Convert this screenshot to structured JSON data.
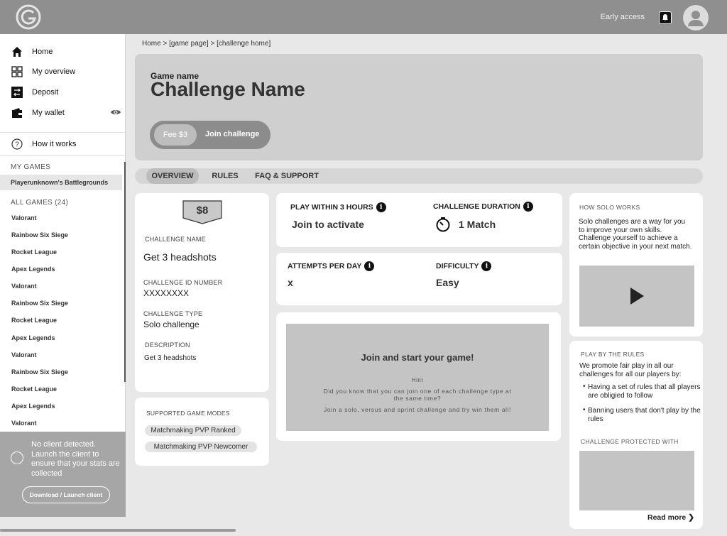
{
  "topbar": {
    "early_access": "Early access"
  },
  "sidebar": {
    "nav": [
      {
        "label": "Home",
        "icon": "home-icon"
      },
      {
        "label": "My overview",
        "icon": "grid-icon"
      },
      {
        "label": "Deposit",
        "icon": "swap-icon"
      },
      {
        "label": "My wallet",
        "icon": "wallet-icon"
      }
    ],
    "how_it_works": "How it works",
    "my_games_title": "MY GAMES",
    "my_games": [
      "Playerunknown's Battlegrounds"
    ],
    "all_games_title": "ALL GAMES (24)",
    "all_games": [
      "Valorant",
      "Rainbow Six Siege",
      "Rocket League",
      "Apex Legends",
      "Valorant",
      "Rainbow Six Siege",
      "Rocket League",
      "Apex Legends",
      "Valorant",
      "Rainbow Six Siege",
      "Rocket League",
      "Apex Legends",
      "Valorant"
    ],
    "client_message": "No client detected. Launch the client to ensure that your stats are collected",
    "download_button": "Download / Launch client"
  },
  "breadcrumb": "Home > [game page] > [challenge home]",
  "hero": {
    "game_name": "Game name",
    "challenge_name": "Challenge Name",
    "fee": "Fee $3",
    "join": "Join challenge"
  },
  "tabs": [
    "OVERVIEW",
    "RULES",
    "FAQ & SUPPORT"
  ],
  "details": {
    "price": "$8",
    "name_label": "CHALLENGE NAME",
    "name_value": "Get 3 headshots",
    "id_label": "CHALLENGE ID NUMBER",
    "id_value": "XXXXXXXX",
    "type_label": "CHALLENGE TYPE",
    "type_value": "Solo challenge",
    "desc_label": "DESCRIPTION",
    "desc_value": "Get 3 headshots"
  },
  "modes": {
    "title": "SUPPORTED GAME MODES",
    "items": [
      "Matchmaking PVP Ranked",
      "Matchmaking PVP Newcomer"
    ]
  },
  "stats": {
    "play_within_label": "PLAY WITHIN 3 HOURS",
    "play_within_value": "Join to activate",
    "duration_label": "CHALLENGE DURATION",
    "duration_value": "1 Match",
    "attempts_label": "ATTEMPTS PER DAY",
    "attempts_value": "x",
    "difficulty_label": "DIFFICULTY",
    "difficulty_value": "Easy",
    "info_glyph": "i"
  },
  "hint": {
    "title": "Join and start your game!",
    "label": "Hint",
    "line1": "Did you know that you can join one of each challenge type at the same time?",
    "line2": "Join a solo, versus and sprint challenge and try win them all!"
  },
  "how_solo": {
    "title": "HOW SOLO WORKS",
    "text": "Solo challenges are a way for you to improve your own skills. Challenge yourself to achieve a certain objective in your next match."
  },
  "rules": {
    "title": "PLAY BY THE RULES",
    "intro": "We promote fair play in all our challenges for all our players by:",
    "bullets": [
      "Having a set of rules that all players are obligied to follow",
      "Banning users that don't play by the rules"
    ],
    "protected_title": "CHALLENGE PROTECTED WITH",
    "read_more": "Read more"
  }
}
